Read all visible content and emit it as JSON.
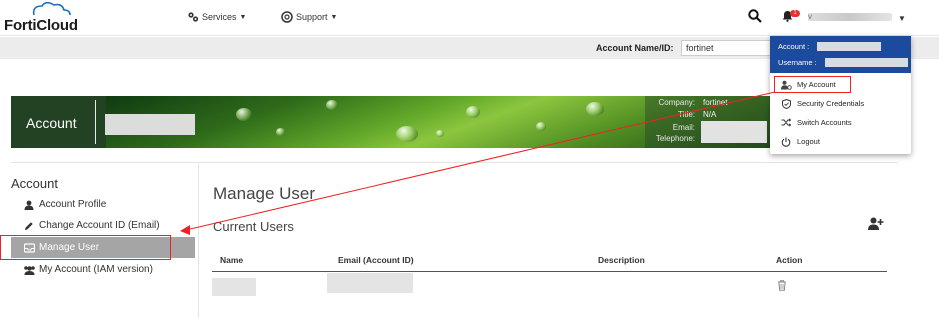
{
  "brand": {
    "logo_text": "FortiCloud"
  },
  "nav": {
    "services_label": "Services",
    "support_label": "Support",
    "notification_count": "1",
    "user_initial": "v"
  },
  "account_bar": {
    "label": "Account Name/ID:",
    "value": "fortinet"
  },
  "banner": {
    "title": "Account",
    "company_label": "Company:",
    "company_value": "fortinet",
    "title_label": "Title:",
    "title_value": "N/A",
    "email_label": "Email:",
    "telephone_label": "Telephone:"
  },
  "sidebar": {
    "heading": "Account",
    "items": [
      {
        "label": "Account Profile",
        "icon": "user-icon"
      },
      {
        "label": "Change Account ID (Email)",
        "icon": "pencil-icon"
      },
      {
        "label": "Manage User",
        "icon": "inbox-icon",
        "active": true
      },
      {
        "label": "My Account (IAM version)",
        "icon": "users-icon"
      }
    ]
  },
  "main": {
    "title": "Manage User",
    "section_title": "Current Users",
    "columns": [
      "Name",
      "Email (Account ID)",
      "Description",
      "Action"
    ]
  },
  "dropdown": {
    "account_label": "Account :",
    "username_label": "Username :",
    "items": [
      {
        "label": "My Account",
        "icon": "account-gear-icon"
      },
      {
        "label": "Security Credentials",
        "icon": "shield-icon"
      },
      {
        "label": "Switch Accounts",
        "icon": "shuffle-icon"
      },
      {
        "label": "Logout",
        "icon": "power-icon"
      }
    ]
  },
  "colors": {
    "accent": "#1c4a9c",
    "active_nav": "#a5a5a5",
    "annotation": "#ee2222",
    "badge": "#e3342f"
  }
}
